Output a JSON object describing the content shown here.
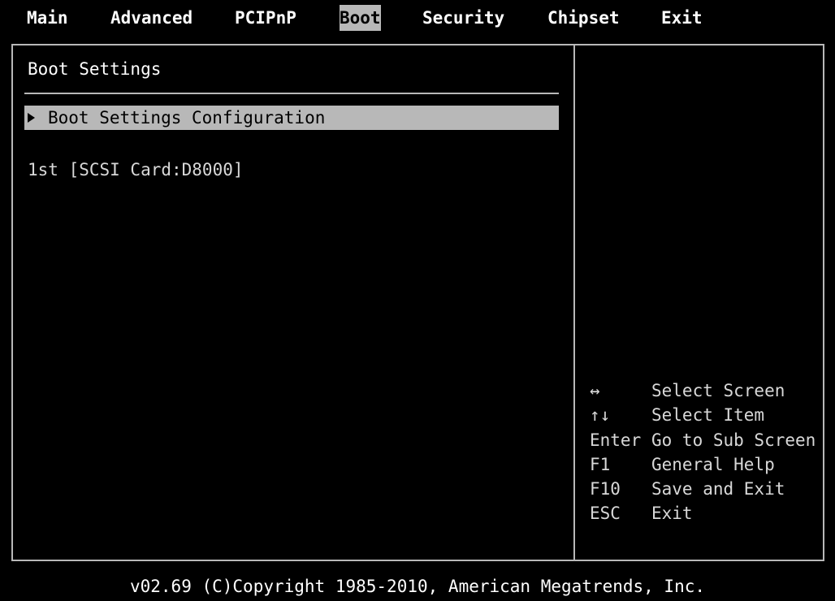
{
  "menu": {
    "tabs": [
      {
        "label": "Main"
      },
      {
        "label": "Advanced"
      },
      {
        "label": "PCIPnP"
      },
      {
        "label": "Boot"
      },
      {
        "label": "Security"
      },
      {
        "label": "Chipset"
      },
      {
        "label": "Exit"
      }
    ],
    "active_tab": "Boot"
  },
  "main": {
    "title": "Boot Settings",
    "submenu_item": "Boot Settings Configuration",
    "boot_device": "1st [SCSI Card:D8000]"
  },
  "help": {
    "rows": [
      {
        "key": "↔",
        "desc": "Select Screen"
      },
      {
        "key": "↑↓",
        "desc": "Select Item"
      },
      {
        "key": "Enter",
        "desc": "Go to Sub Screen"
      },
      {
        "key": "F1",
        "desc": "General Help"
      },
      {
        "key": "F10",
        "desc": "Save and Exit"
      },
      {
        "key": "ESC",
        "desc": "Exit"
      }
    ]
  },
  "footer": {
    "text": "v02.69 (C)Copyright 1985-2010, American Megatrends, Inc."
  },
  "colors": {
    "background": "#000000",
    "highlight": "#b8b8b8",
    "text": "#d8d8d8"
  }
}
